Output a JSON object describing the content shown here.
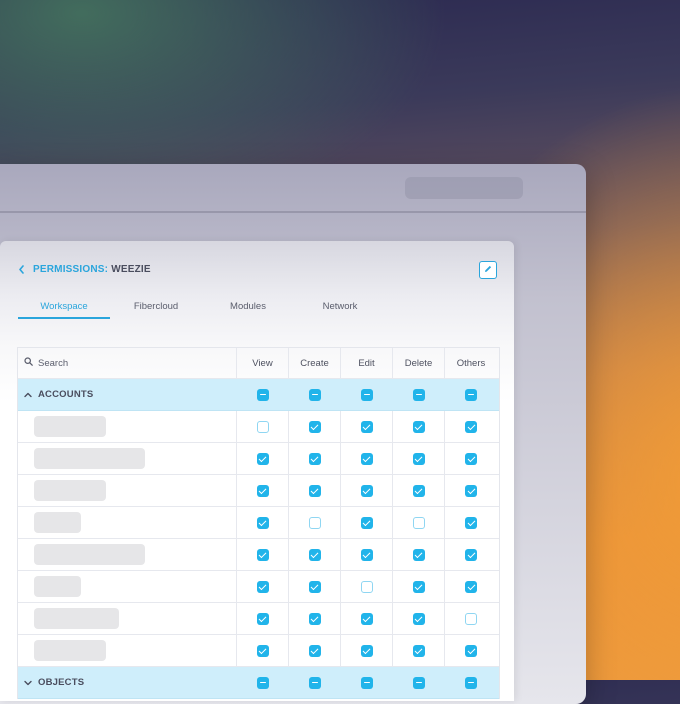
{
  "header": {
    "permissions_label": "PERMISSIONS:",
    "user_name": "WEEZIE"
  },
  "tabs": [
    {
      "label": "Workspace",
      "active": true
    },
    {
      "label": "Fibercloud",
      "active": false
    },
    {
      "label": "Modules",
      "active": false
    },
    {
      "label": "Network",
      "active": false
    }
  ],
  "table": {
    "search_placeholder": "Search",
    "columns": [
      "View",
      "Create",
      "Edit",
      "Delete",
      "Others"
    ],
    "groups": [
      {
        "label": "ACCOUNTS",
        "expanded": true,
        "header_state": [
          "partial",
          "partial",
          "partial",
          "partial",
          "partial"
        ],
        "rows": [
          {
            "name_placeholder_level": 0.55,
            "perms": [
              false,
              true,
              true,
              true,
              true
            ]
          },
          {
            "name_placeholder_level": 0.85,
            "perms": [
              true,
              true,
              true,
              true,
              true
            ]
          },
          {
            "name_placeholder_level": 0.55,
            "perms": [
              true,
              true,
              true,
              true,
              true
            ]
          },
          {
            "name_placeholder_level": 0.36,
            "perms": [
              true,
              false,
              true,
              false,
              true
            ]
          },
          {
            "name_placeholder_level": 0.85,
            "perms": [
              true,
              true,
              true,
              true,
              true
            ]
          },
          {
            "name_placeholder_level": 0.36,
            "perms": [
              true,
              true,
              false,
              true,
              true
            ]
          },
          {
            "name_placeholder_level": 0.65,
            "perms": [
              true,
              true,
              true,
              true,
              false
            ]
          },
          {
            "name_placeholder_level": 0.55,
            "perms": [
              true,
              true,
              true,
              true,
              true
            ]
          }
        ]
      },
      {
        "label": "OBJECTS",
        "expanded": false,
        "header_state": [
          "partial",
          "partial",
          "partial",
          "partial",
          "partial"
        ],
        "rows": []
      }
    ]
  },
  "colors": {
    "accent": "#21b4ea",
    "group_bg": "#cfeefb",
    "text": "#4a4d5e"
  }
}
